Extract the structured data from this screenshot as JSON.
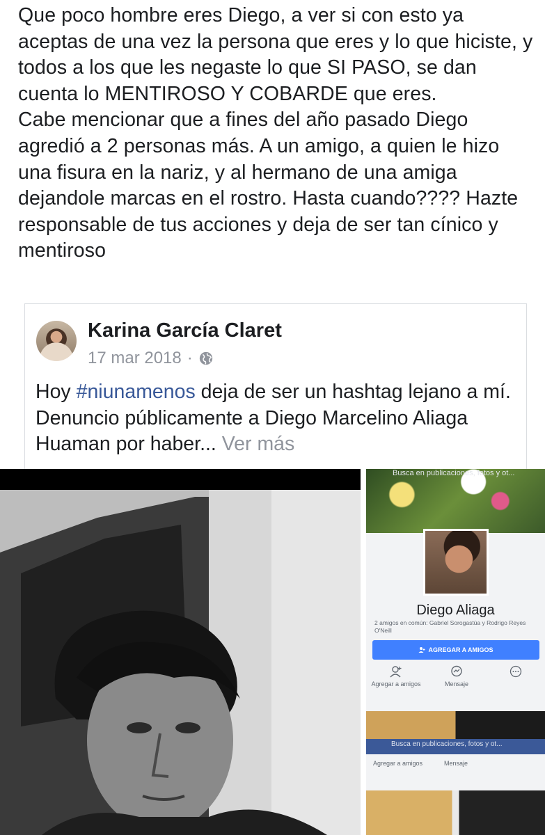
{
  "post": {
    "paragraph1": "Que poco hombre eres Diego, a ver si con esto ya aceptas de una vez la persona que eres y lo que hiciste, y todos a los que les negaste lo que SI PASO, se dan cuenta lo MENTIROSO Y COBARDE que eres.",
    "paragraph2": "Cabe mencionar que a fines del año pasado Diego agredió a 2 personas más. A un amigo, a quien le hizo una fisura en la nariz, y al hermano de una amiga dejandole marcas en el rostro. Hasta cuando???? Hazte responsable de tus acciones y deja de ser tan cínico y mentiroso"
  },
  "shared_post": {
    "author": "Karina García Claret",
    "date": "17 mar 2018",
    "separator": "·",
    "text_before": "Hoy ",
    "hashtag": "#niunamenos",
    "text_after": " deja de ser un hashtag lejano a mí. Denuncio públicamente a Diego Marcelino Aliaga Huaman por haber...",
    "see_more": "Ver más"
  },
  "profile_screenshot": {
    "search_placeholder": "Busca en publicaciones, fotos y ot...",
    "name": "Diego Aliaga",
    "mutual_friends": "2 amigos en común: Gabriel Sorogastúa y Rodrigo Reyes O'Neill",
    "add_friend_button": "AGREGAR A AMIGOS",
    "action_add": "Agregar a amigos",
    "action_message": "Mensaje",
    "search_placeholder_2": "Busca en publicaciones, fotos y ot...",
    "action_add_2": "Agregar a amigos",
    "action_message_2": "Mensaje"
  },
  "colors": {
    "hashtag": "#385898",
    "muted": "#90949c",
    "button": "#4080ff"
  }
}
